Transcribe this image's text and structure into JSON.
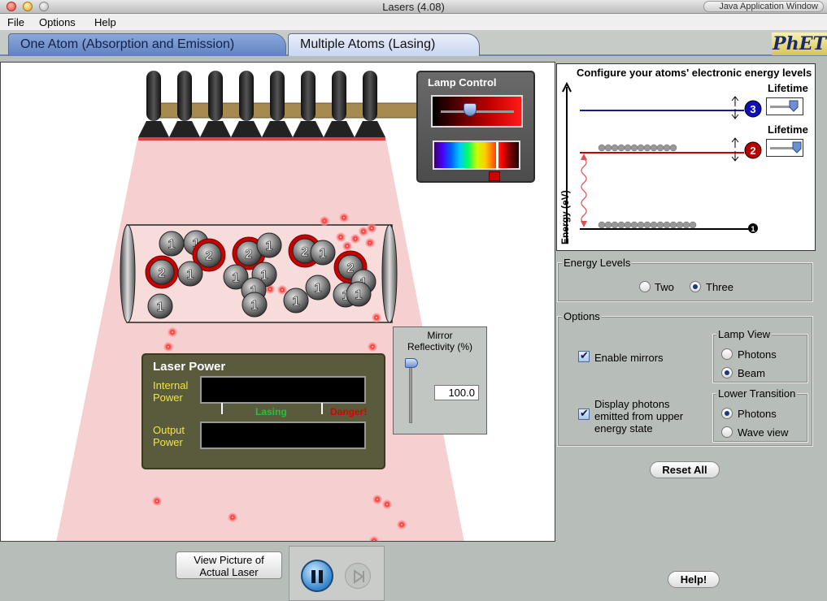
{
  "window": {
    "title": "Lasers (4.08)",
    "java_label": "Java Application Window"
  },
  "menu": [
    "File",
    "Options",
    "Help"
  ],
  "tabs": [
    "One Atom (Absorption and Emission)",
    "Multiple Atoms (Lasing)"
  ],
  "logo": "PhET",
  "lamp_control": {
    "title": "Lamp Control",
    "intensity_fraction": 0.42
  },
  "laser_power": {
    "title": "Laser Power",
    "internal_label": "Internal\nPower",
    "output_label": "Output\nPower",
    "lasing": "Lasing",
    "danger": "Danger!"
  },
  "mirror": {
    "title": "Mirror\nReflectivity (%)",
    "value": "100.0"
  },
  "atoms": {
    "labels": [
      "1",
      "2"
    ]
  },
  "energy_diagram": {
    "title": "Configure your atoms' electronic energy levels",
    "lifetime_label": "Lifetime",
    "y_axis": "Energy (eV)",
    "levels": [
      "3",
      "2",
      "1"
    ]
  },
  "energy_levels": {
    "title": "Energy Levels",
    "two": "Two",
    "three": "Three",
    "selected": "Three"
  },
  "options": {
    "title": "Options",
    "enable_mirrors": "Enable mirrors",
    "display_photons": "Display photons\nemitted from upper\nenergy state",
    "lamp_view": {
      "title": "Lamp View",
      "photons": "Photons",
      "beam": "Beam",
      "selected": "Beam"
    },
    "lower_transition": {
      "title": "Lower Transition",
      "photons": "Photons",
      "wave": "Wave view",
      "selected": "Photons"
    }
  },
  "buttons": {
    "reset_all": "Reset All",
    "help": "Help!",
    "view_picture": "View Picture of\nActual Laser"
  }
}
